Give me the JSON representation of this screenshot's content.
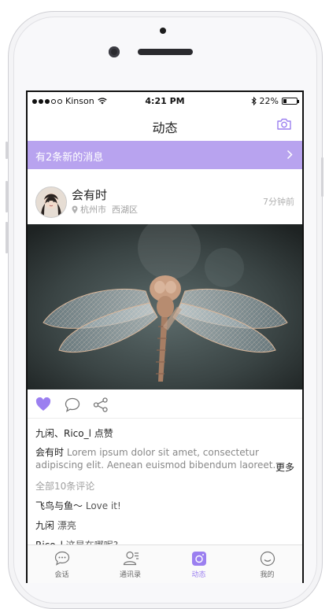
{
  "statusbar": {
    "carrier": "Kinson",
    "time": "4:21 PM",
    "battery": "22%",
    "battery_level": 0.22
  },
  "navbar": {
    "title": "动态",
    "camera_icon": "camera-icon"
  },
  "banner": {
    "text": "有2条新的消息",
    "icon": "chevron-right-icon"
  },
  "post": {
    "author": "会有时",
    "city": "杭州市",
    "district": "西湖区",
    "time_ago": "7分钟前",
    "likes_text": "九闲、Rico_l 点赞",
    "content_author": "会有时",
    "content_text": "Lorem ipsum dolor sit amet, consectetur adipiscing elit. Aenean euismod bibendum laoreet.",
    "more_label": "更多",
    "comments_all": "全部10条评论",
    "comments": [
      {
        "name": "飞鸟与鱼～",
        "text": "Love it!"
      },
      {
        "name": "九闲",
        "text": "漂亮"
      },
      {
        "name": "Rico_l",
        "text": "这是在哪呢?"
      }
    ]
  },
  "tabs": [
    {
      "label": "会话",
      "icon": "chat-bubble-icon"
    },
    {
      "label": "通讯录",
      "icon": "contacts-icon"
    },
    {
      "label": "动态",
      "icon": "moments-icon",
      "active": true
    },
    {
      "label": "我的",
      "icon": "smiley-icon"
    }
  ],
  "colors": {
    "accent": "#9b7ff0",
    "banner": "#b8a3ef"
  }
}
